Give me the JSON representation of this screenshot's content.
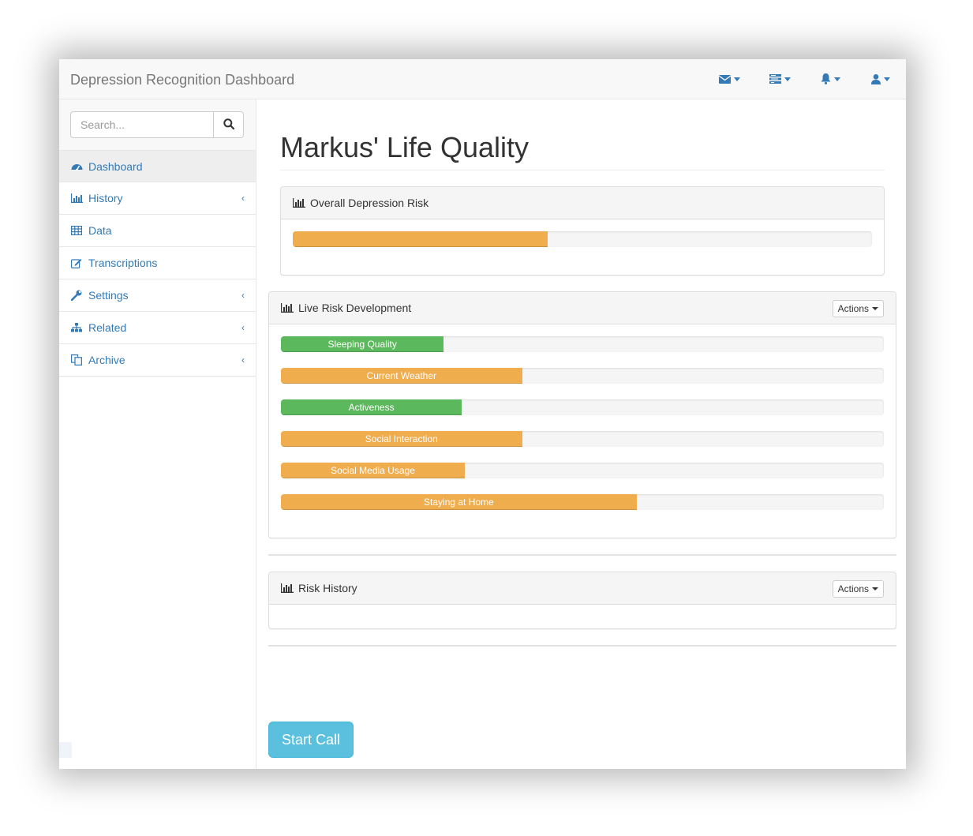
{
  "navbar": {
    "brand": "Depression Recognition Dashboard",
    "icons": [
      "envelope-icon",
      "tasks-icon",
      "bell-icon",
      "user-icon"
    ]
  },
  "sidebar": {
    "search": {
      "placeholder": "Search...",
      "value": ""
    },
    "items": [
      {
        "label": "Dashboard",
        "icon": "dashboard-icon",
        "active": true,
        "submenu": false
      },
      {
        "label": "History",
        "icon": "bar-chart-icon",
        "active": false,
        "submenu": true
      },
      {
        "label": "Data",
        "icon": "table-icon",
        "active": false,
        "submenu": false
      },
      {
        "label": "Transcriptions",
        "icon": "edit-icon",
        "active": false,
        "submenu": false
      },
      {
        "label": "Settings",
        "icon": "wrench-icon",
        "active": false,
        "submenu": true
      },
      {
        "label": "Related",
        "icon": "sitemap-icon",
        "active": false,
        "submenu": true
      },
      {
        "label": "Archive",
        "icon": "files-icon",
        "active": false,
        "submenu": true
      }
    ]
  },
  "main": {
    "title": "Markus' Life Quality",
    "overall": {
      "heading": "Overall Depression Risk",
      "progress": 0.44,
      "color": "#f0ad4e"
    },
    "live": {
      "heading": "Live Risk Development",
      "actions_label": "Actions",
      "bars": [
        {
          "label": "Sleeping Quality",
          "value": 0.27,
          "color": "#5cb85c"
        },
        {
          "label": "Current Weather",
          "value": 0.4,
          "color": "#f0ad4e"
        },
        {
          "label": "Activeness",
          "value": 0.3,
          "color": "#5cb85c"
        },
        {
          "label": "Social Interaction",
          "value": 0.4,
          "color": "#f0ad4e"
        },
        {
          "label": "Social Media Usage",
          "value": 0.305,
          "color": "#f0ad4e"
        },
        {
          "label": "Staying at Home",
          "value": 0.59,
          "color": "#f0ad4e"
        }
      ]
    },
    "history": {
      "heading": "Risk History",
      "actions_label": "Actions"
    },
    "start_call_label": "Start Call"
  },
  "colors": {
    "link": "#337ab7",
    "success": "#5cb85c",
    "warning": "#f0ad4e",
    "info": "#5bc0de"
  }
}
